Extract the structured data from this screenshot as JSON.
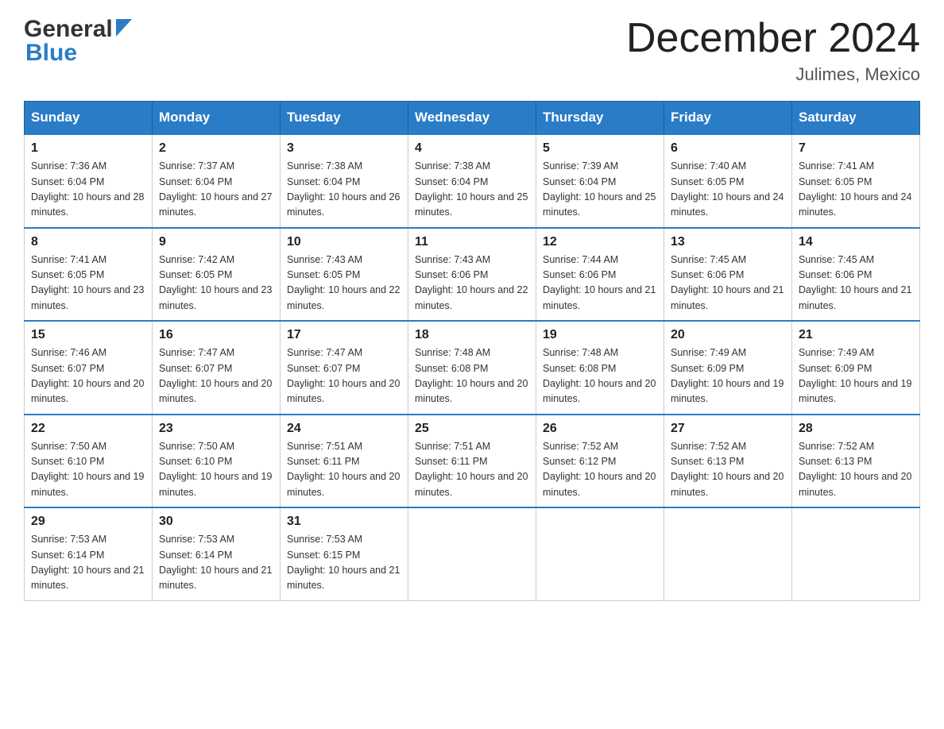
{
  "header": {
    "logo_general": "General",
    "logo_blue": "Blue",
    "title": "December 2024",
    "subtitle": "Julimes, Mexico"
  },
  "days_of_week": [
    "Sunday",
    "Monday",
    "Tuesday",
    "Wednesday",
    "Thursday",
    "Friday",
    "Saturday"
  ],
  "weeks": [
    [
      {
        "day": "1",
        "sunrise": "7:36 AM",
        "sunset": "6:04 PM",
        "daylight": "10 hours and 28 minutes."
      },
      {
        "day": "2",
        "sunrise": "7:37 AM",
        "sunset": "6:04 PM",
        "daylight": "10 hours and 27 minutes."
      },
      {
        "day": "3",
        "sunrise": "7:38 AM",
        "sunset": "6:04 PM",
        "daylight": "10 hours and 26 minutes."
      },
      {
        "day": "4",
        "sunrise": "7:38 AM",
        "sunset": "6:04 PM",
        "daylight": "10 hours and 25 minutes."
      },
      {
        "day": "5",
        "sunrise": "7:39 AM",
        "sunset": "6:04 PM",
        "daylight": "10 hours and 25 minutes."
      },
      {
        "day": "6",
        "sunrise": "7:40 AM",
        "sunset": "6:05 PM",
        "daylight": "10 hours and 24 minutes."
      },
      {
        "day": "7",
        "sunrise": "7:41 AM",
        "sunset": "6:05 PM",
        "daylight": "10 hours and 24 minutes."
      }
    ],
    [
      {
        "day": "8",
        "sunrise": "7:41 AM",
        "sunset": "6:05 PM",
        "daylight": "10 hours and 23 minutes."
      },
      {
        "day": "9",
        "sunrise": "7:42 AM",
        "sunset": "6:05 PM",
        "daylight": "10 hours and 23 minutes."
      },
      {
        "day": "10",
        "sunrise": "7:43 AM",
        "sunset": "6:05 PM",
        "daylight": "10 hours and 22 minutes."
      },
      {
        "day": "11",
        "sunrise": "7:43 AM",
        "sunset": "6:06 PM",
        "daylight": "10 hours and 22 minutes."
      },
      {
        "day": "12",
        "sunrise": "7:44 AM",
        "sunset": "6:06 PM",
        "daylight": "10 hours and 21 minutes."
      },
      {
        "day": "13",
        "sunrise": "7:45 AM",
        "sunset": "6:06 PM",
        "daylight": "10 hours and 21 minutes."
      },
      {
        "day": "14",
        "sunrise": "7:45 AM",
        "sunset": "6:06 PM",
        "daylight": "10 hours and 21 minutes."
      }
    ],
    [
      {
        "day": "15",
        "sunrise": "7:46 AM",
        "sunset": "6:07 PM",
        "daylight": "10 hours and 20 minutes."
      },
      {
        "day": "16",
        "sunrise": "7:47 AM",
        "sunset": "6:07 PM",
        "daylight": "10 hours and 20 minutes."
      },
      {
        "day": "17",
        "sunrise": "7:47 AM",
        "sunset": "6:07 PM",
        "daylight": "10 hours and 20 minutes."
      },
      {
        "day": "18",
        "sunrise": "7:48 AM",
        "sunset": "6:08 PM",
        "daylight": "10 hours and 20 minutes."
      },
      {
        "day": "19",
        "sunrise": "7:48 AM",
        "sunset": "6:08 PM",
        "daylight": "10 hours and 20 minutes."
      },
      {
        "day": "20",
        "sunrise": "7:49 AM",
        "sunset": "6:09 PM",
        "daylight": "10 hours and 19 minutes."
      },
      {
        "day": "21",
        "sunrise": "7:49 AM",
        "sunset": "6:09 PM",
        "daylight": "10 hours and 19 minutes."
      }
    ],
    [
      {
        "day": "22",
        "sunrise": "7:50 AM",
        "sunset": "6:10 PM",
        "daylight": "10 hours and 19 minutes."
      },
      {
        "day": "23",
        "sunrise": "7:50 AM",
        "sunset": "6:10 PM",
        "daylight": "10 hours and 19 minutes."
      },
      {
        "day": "24",
        "sunrise": "7:51 AM",
        "sunset": "6:11 PM",
        "daylight": "10 hours and 20 minutes."
      },
      {
        "day": "25",
        "sunrise": "7:51 AM",
        "sunset": "6:11 PM",
        "daylight": "10 hours and 20 minutes."
      },
      {
        "day": "26",
        "sunrise": "7:52 AM",
        "sunset": "6:12 PM",
        "daylight": "10 hours and 20 minutes."
      },
      {
        "day": "27",
        "sunrise": "7:52 AM",
        "sunset": "6:13 PM",
        "daylight": "10 hours and 20 minutes."
      },
      {
        "day": "28",
        "sunrise": "7:52 AM",
        "sunset": "6:13 PM",
        "daylight": "10 hours and 20 minutes."
      }
    ],
    [
      {
        "day": "29",
        "sunrise": "7:53 AM",
        "sunset": "6:14 PM",
        "daylight": "10 hours and 21 minutes."
      },
      {
        "day": "30",
        "sunrise": "7:53 AM",
        "sunset": "6:14 PM",
        "daylight": "10 hours and 21 minutes."
      },
      {
        "day": "31",
        "sunrise": "7:53 AM",
        "sunset": "6:15 PM",
        "daylight": "10 hours and 21 minutes."
      },
      null,
      null,
      null,
      null
    ]
  ],
  "labels": {
    "sunrise": "Sunrise: ",
    "sunset": "Sunset: ",
    "daylight": "Daylight: "
  }
}
